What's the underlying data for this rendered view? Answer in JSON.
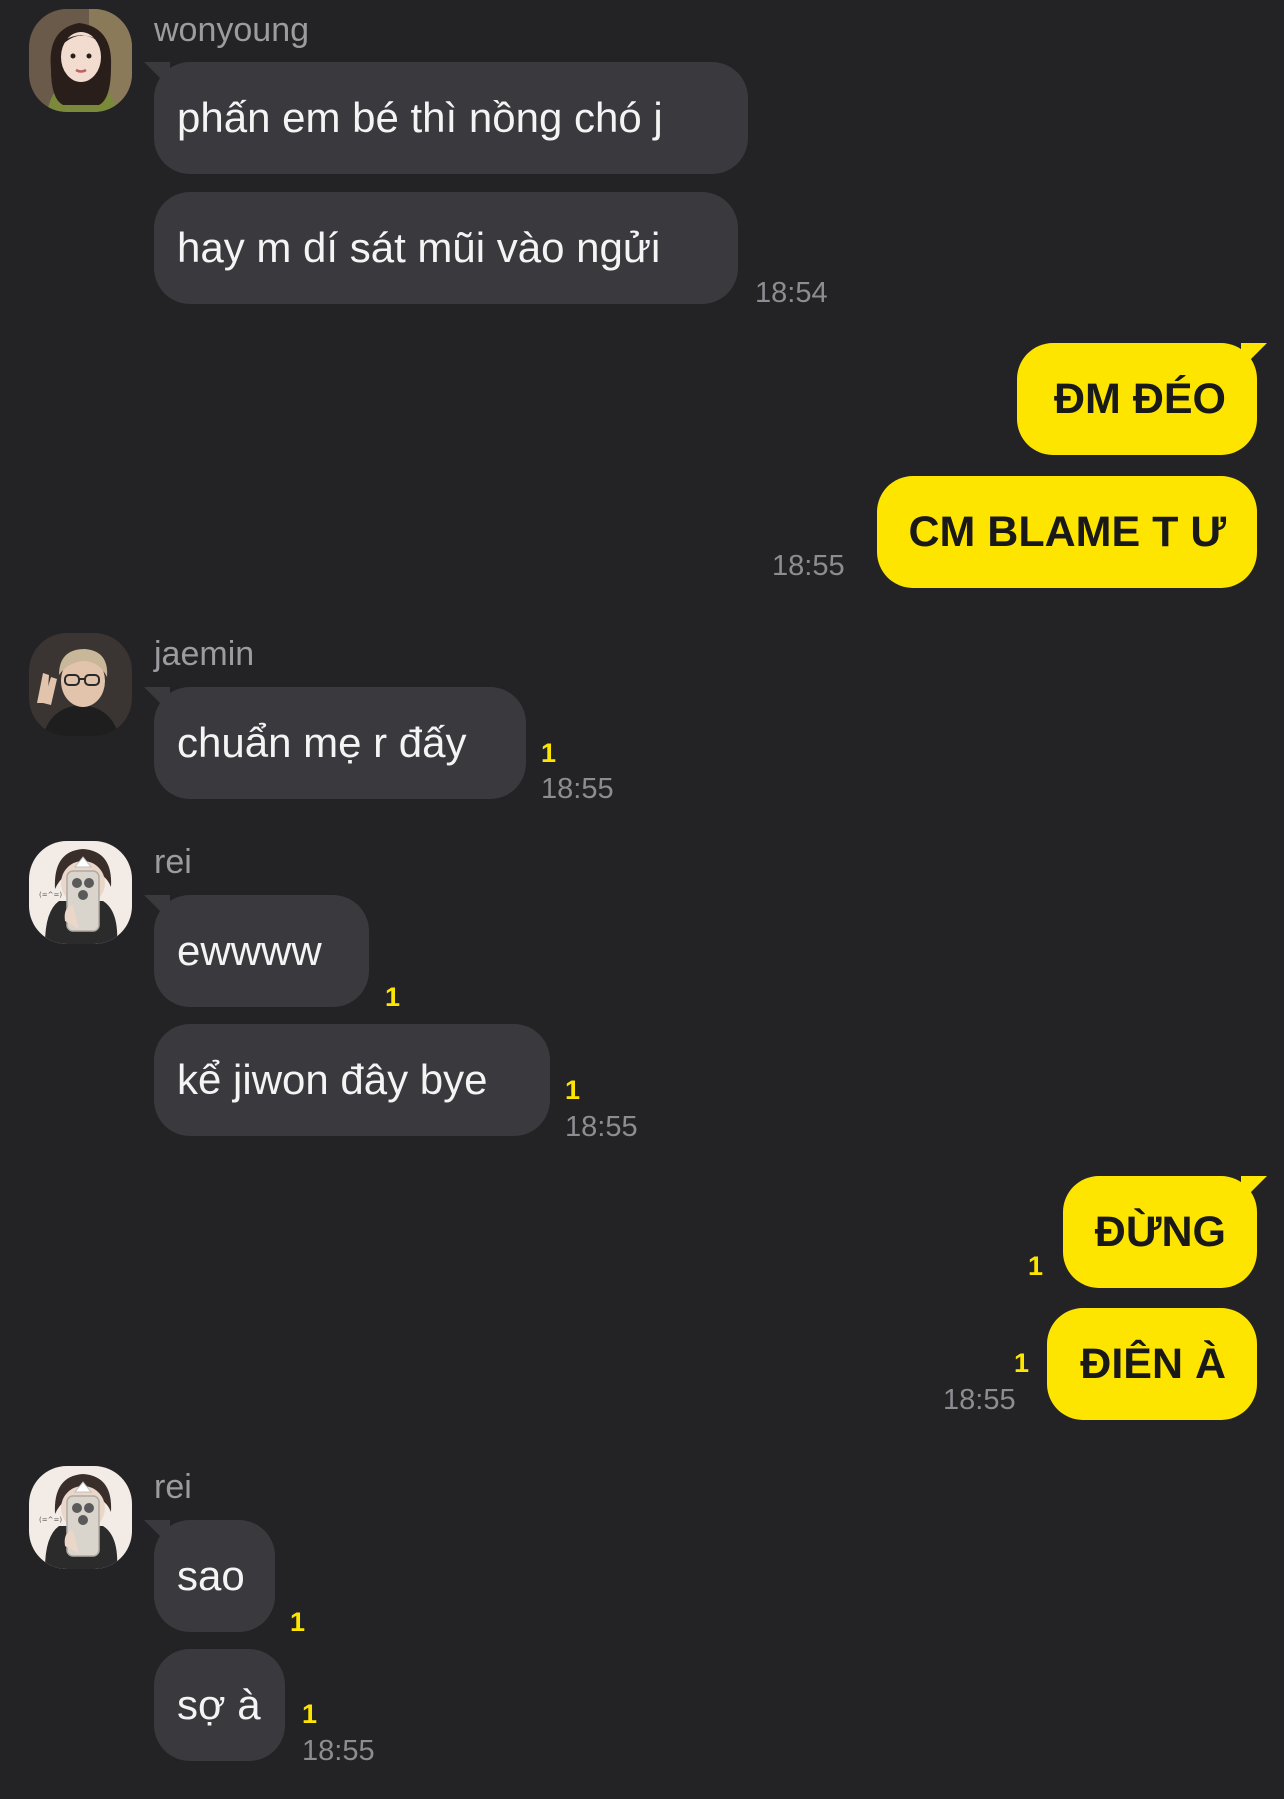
{
  "colors": {
    "background": "#232326",
    "incoming_bubble": "#3a3a3e",
    "outgoing_bubble": "#fee500",
    "unread_count": "#fee500",
    "timestamp": "#8c8c91",
    "sender_name": "#9b9ba0"
  },
  "groups": [
    {
      "sender": "wonyoung",
      "avatar_icon": "profile-avatar-wonyoung",
      "messages": [
        {
          "text": "phấn em bé thì nồng chó j"
        },
        {
          "text": "hay m dí sát mũi vào ngửi",
          "time": "18:54"
        }
      ]
    },
    {
      "sender": "me",
      "messages": [
        {
          "text": "ĐM ĐÉO"
        },
        {
          "text": "CM BLAME T Ư",
          "time": "18:55"
        }
      ]
    },
    {
      "sender": "jaemin",
      "avatar_icon": "profile-avatar-jaemin",
      "messages": [
        {
          "text": "chuẩn mẹ r đấy",
          "unread": "1",
          "time": "18:55"
        }
      ]
    },
    {
      "sender": "rei",
      "avatar_icon": "profile-avatar-rei",
      "messages": [
        {
          "text": "ewwww",
          "unread": "1"
        },
        {
          "text": "kể jiwon đây bye",
          "unread": "1",
          "time": "18:55"
        }
      ]
    },
    {
      "sender": "me",
      "messages": [
        {
          "text": "ĐỪNG",
          "unread": "1"
        },
        {
          "text": "ĐIÊN À",
          "unread": "1",
          "time": "18:55"
        }
      ]
    },
    {
      "sender": "rei",
      "avatar_icon": "profile-avatar-rei",
      "messages": [
        {
          "text": "sao",
          "unread": "1"
        },
        {
          "text": "sợ à",
          "unread": "1",
          "time": "18:55"
        }
      ]
    }
  ]
}
